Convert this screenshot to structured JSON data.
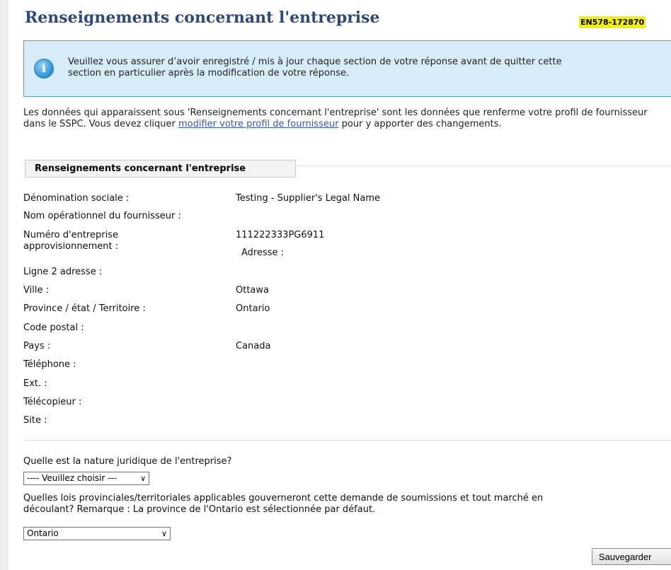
{
  "header": {
    "title": "Renseignements concernant l'entreprise",
    "reference": "EN578-172870"
  },
  "notice": {
    "icon": "info-icon",
    "line1": "Veuillez vous assurer d’avoir enregistré / mis à jour chaque section de votre réponse avant de quitter cette",
    "line2": "section en particulier après la modification de votre réponse."
  },
  "intro": {
    "text_before": "Les données qui apparaissent sous 'Renseignements concernant l'entreprise' sont les données que renferme votre profil de fournisseur dans le SSPC. Vous devez cliquer ",
    "link": "modifier votre profil de fournisseur",
    "text_after": " pour y apporter des changements."
  },
  "section": {
    "tab_label": "Renseignements concernant l'entreprise",
    "fields": {
      "legal_name_label": "Dénomination sociale :",
      "legal_name_value": "Testing - Supplier's Legal Name",
      "operating_name_label": "Nom opérationnel du fournisseur :",
      "pbn_label_line1": "Numéro d'entreprise",
      "pbn_label_line2": "approvisionnement :",
      "pbn_value": "111222333PG6911",
      "address_label": "Adresse :",
      "address2_label": "Ligne 2 adresse :",
      "city_label": "Ville :",
      "city_value": "Ottawa",
      "province_label": "Province / état / Territoire :",
      "province_value": "Ontario",
      "postal_label": "Code postal :",
      "country_label": "Pays :",
      "country_value": "Canada",
      "phone_label": "Téléphone :",
      "ext_label": "Ext. :",
      "fax_label": "Télécopieur :",
      "site_label": "Site :"
    }
  },
  "form": {
    "legal_nature_question": "Quelle est la nature juridique de l'entreprise?",
    "legal_nature_selected": "---- Veuillez choisir ---",
    "laws_question_line1": "Quelles lois provinciales/territoriales applicables gouverneront cette demande de soumissions et tout marché en",
    "laws_question_line2": "découlant? Remarque : La province de l'Ontario est sélectionnée par défaut.",
    "laws_selected": "Ontario",
    "save_label": "Sauvegarder"
  }
}
